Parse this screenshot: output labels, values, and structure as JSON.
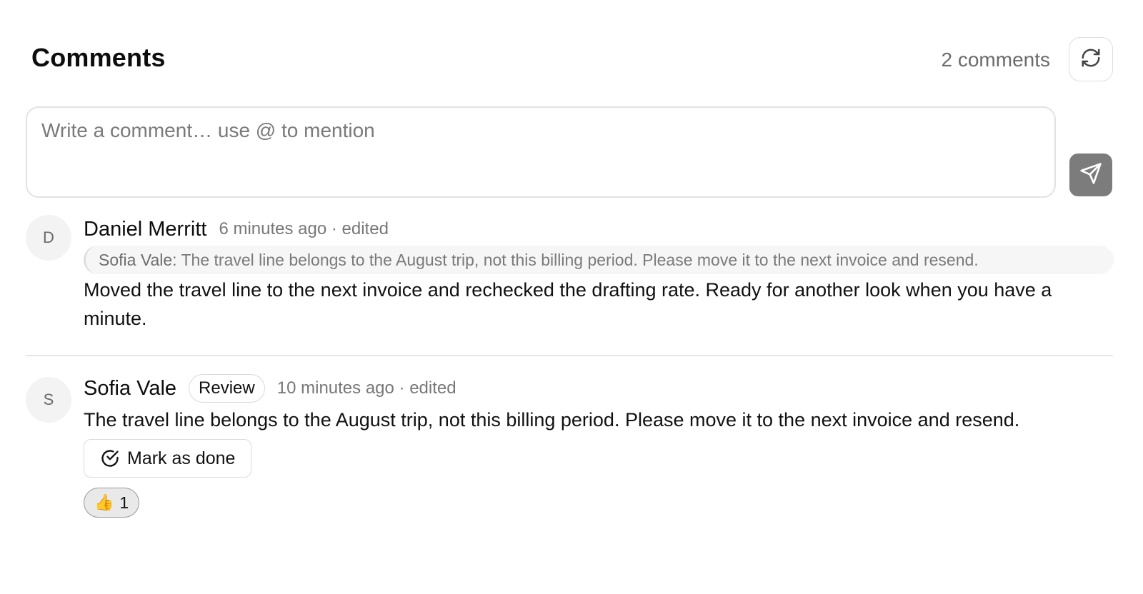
{
  "header": {
    "title": "Comments",
    "count": "2 comments",
    "refresh_icon": "refresh-icon"
  },
  "composer": {
    "placeholder": "Write a comment… use @ to mention",
    "value": "",
    "send_icon": "send-icon"
  },
  "comments": [
    {
      "avatar": "D",
      "author": "Daniel Merritt",
      "time": "6 minutes ago · edited",
      "quote_author": "Sofia Vale:",
      "quote_text": " The travel line belongs to the August trip, not this billing period. Please move it to the next invoice and resend.",
      "body": "Moved the travel line to the next invoice and rechecked the drafting rate. Ready for another look when you have a minute."
    },
    {
      "avatar": "S",
      "author": "Sofia Vale",
      "tag": "Review",
      "time": "10 minutes ago · edited",
      "body": "The travel line belongs to the August trip, not this billing period. Please move it to the next invoice and resend.",
      "done_label": "Mark as done",
      "done_icon": "check-circle-icon",
      "reaction_emoji": "👍",
      "reaction_count": "1"
    }
  ],
  "colors": {
    "send_button": "#7c7c7c",
    "avatar_bg": "#f3f3f3",
    "muted_text": "#777777"
  }
}
